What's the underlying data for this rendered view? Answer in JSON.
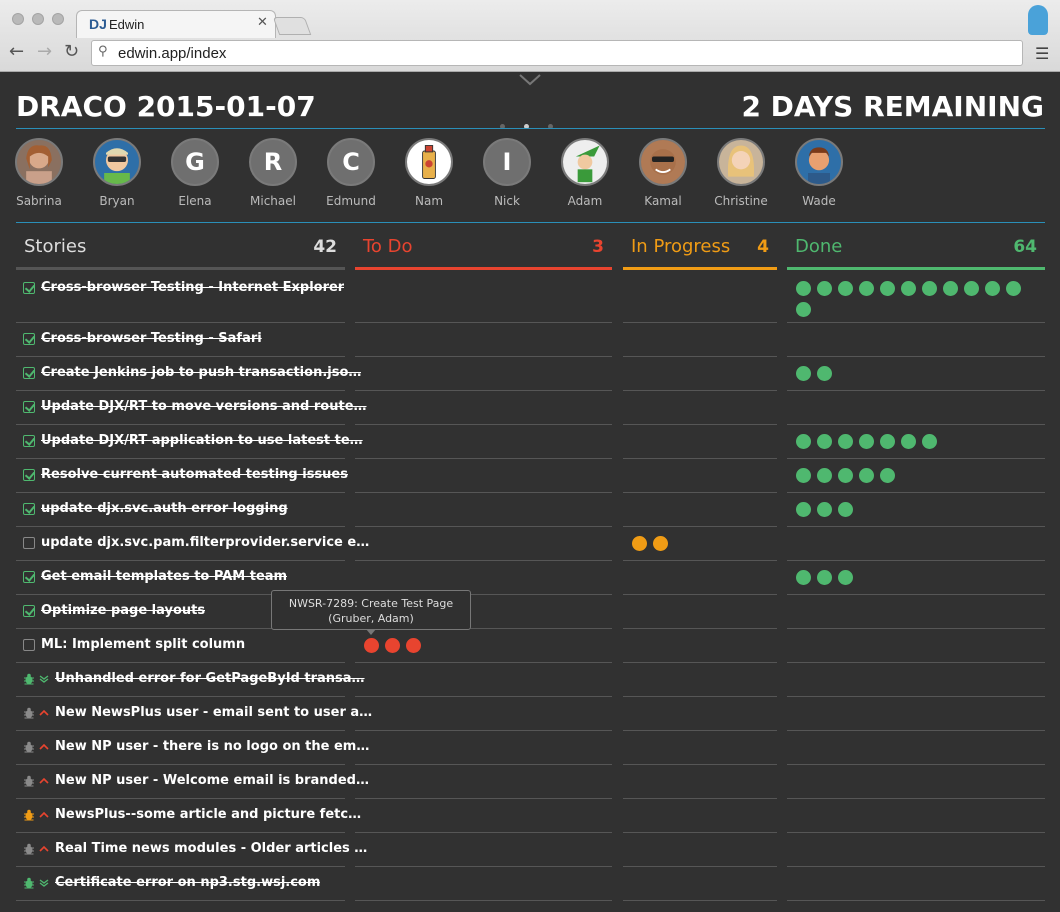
{
  "browser": {
    "tab_logo": "DJ",
    "tab_title": "Edwin",
    "tab_close": "✕",
    "url": "edwin.app/index",
    "back_icon": "arrow-left-icon",
    "forward_icon": "arrow-right-icon",
    "reload_icon": "reload-icon",
    "search_icon": "search-icon",
    "menu_icon": "hamburger-icon"
  },
  "sprint": {
    "title": "DRACO 2015-01-07",
    "remaining": "2 DAYS REMAINING",
    "page_dots": 3,
    "active_dot": 1
  },
  "team": [
    {
      "name": "Sabrina",
      "letter": "",
      "photo": "woman-photo"
    },
    {
      "name": "Bryan",
      "letter": "",
      "photo": "cartoon-sunglasses"
    },
    {
      "name": "Elena",
      "letter": "G",
      "photo": ""
    },
    {
      "name": "Michael",
      "letter": "R",
      "photo": ""
    },
    {
      "name": "Edmund",
      "letter": "C",
      "photo": ""
    },
    {
      "name": "Nam",
      "letter": "",
      "photo": "spray-can"
    },
    {
      "name": "Nick",
      "letter": "I",
      "photo": ""
    },
    {
      "name": "Adam",
      "letter": "",
      "photo": "cartoon-elf"
    },
    {
      "name": "Kamal",
      "letter": "",
      "photo": "man-sunglasses"
    },
    {
      "name": "Christine",
      "letter": "",
      "photo": "blonde-woman"
    },
    {
      "name": "Wade",
      "letter": "",
      "photo": "cartoon-man"
    }
  ],
  "columns": {
    "stories": {
      "label": "Stories",
      "count": "42"
    },
    "todo": {
      "label": "To Do",
      "count": "3"
    },
    "progress": {
      "label": "In Progress",
      "count": "4"
    },
    "done": {
      "label": "Done",
      "count": "64"
    }
  },
  "colors": {
    "todo": "#e8442f",
    "progress": "#f09c15",
    "done": "#4fb86f",
    "rule": "#2a8fb8"
  },
  "stories": [
    {
      "title": "Cross-browser Testing - Internet Explorer",
      "kind": "story",
      "checked": true,
      "todo": 0,
      "progress": 0,
      "done": 12
    },
    {
      "title": "Cross-browser Testing - Safari",
      "kind": "story",
      "checked": true,
      "todo": 0,
      "progress": 0,
      "done": 0
    },
    {
      "title": "Create Jenkins job to push transaction.jso…",
      "kind": "story",
      "checked": true,
      "todo": 0,
      "progress": 0,
      "done": 2
    },
    {
      "title": "Update DJX/RT to move versions and route…",
      "kind": "story",
      "checked": true,
      "todo": 0,
      "progress": 0,
      "done": 0
    },
    {
      "title": "Update DJX/RT application to use latest te…",
      "kind": "story",
      "checked": true,
      "todo": 0,
      "progress": 0,
      "done": 7
    },
    {
      "title": "Resolve current automated testing issues",
      "kind": "story",
      "checked": true,
      "todo": 0,
      "progress": 0,
      "done": 5
    },
    {
      "title": "update djx.svc.auth error logging",
      "kind": "story",
      "checked": true,
      "todo": 0,
      "progress": 0,
      "done": 3
    },
    {
      "title": "update djx.svc.pam.filterprovider.service e…",
      "kind": "story",
      "checked": false,
      "todo": 0,
      "progress": 2,
      "done": 0
    },
    {
      "title": "Get email templates to PAM team",
      "kind": "story",
      "checked": true,
      "todo": 0,
      "progress": 0,
      "done": 3
    },
    {
      "title": "Optimize page layouts",
      "kind": "story",
      "checked": true,
      "todo": 0,
      "progress": 0,
      "done": 0
    },
    {
      "title": "ML: Implement split column",
      "kind": "story",
      "checked": false,
      "todo": 3,
      "progress": 0,
      "done": 0
    },
    {
      "title": "Unhandled error for GetPageById transa…",
      "kind": "bug",
      "bug_color": "#4fb86f",
      "prio": "down",
      "done_flag": true,
      "todo": 0,
      "progress": 0,
      "done": 0
    },
    {
      "title": "New NewsPlus user - email sent to user a…",
      "kind": "bug",
      "bug_color": "#8a8a8a",
      "prio": "up",
      "done_flag": false,
      "todo": 0,
      "progress": 0,
      "done": 0
    },
    {
      "title": "New NP user - there is no logo on the em…",
      "kind": "bug",
      "bug_color": "#8a8a8a",
      "prio": "up",
      "done_flag": false,
      "todo": 0,
      "progress": 0,
      "done": 0
    },
    {
      "title": "New NP user - Welcome email is branded…",
      "kind": "bug",
      "bug_color": "#8a8a8a",
      "prio": "up",
      "done_flag": false,
      "todo": 0,
      "progress": 0,
      "done": 0
    },
    {
      "title": "NewsPlus--some article and picture fetc…",
      "kind": "bug",
      "bug_color": "#f09c15",
      "prio": "up",
      "done_flag": false,
      "todo": 0,
      "progress": 0,
      "done": 0
    },
    {
      "title": "Real Time news modules - Older articles …",
      "kind": "bug",
      "bug_color": "#8a8a8a",
      "prio": "up",
      "done_flag": false,
      "todo": 0,
      "progress": 0,
      "done": 0
    },
    {
      "title": "Certificate error on np3.stg.wsj.com",
      "kind": "bug",
      "bug_color": "#4fb86f",
      "prio": "down",
      "done_flag": true,
      "todo": 0,
      "progress": 0,
      "done": 0
    }
  ],
  "tooltip": {
    "line1": "NWSR-7289: Create Test Page",
    "line2": "(Gruber, Adam)"
  }
}
